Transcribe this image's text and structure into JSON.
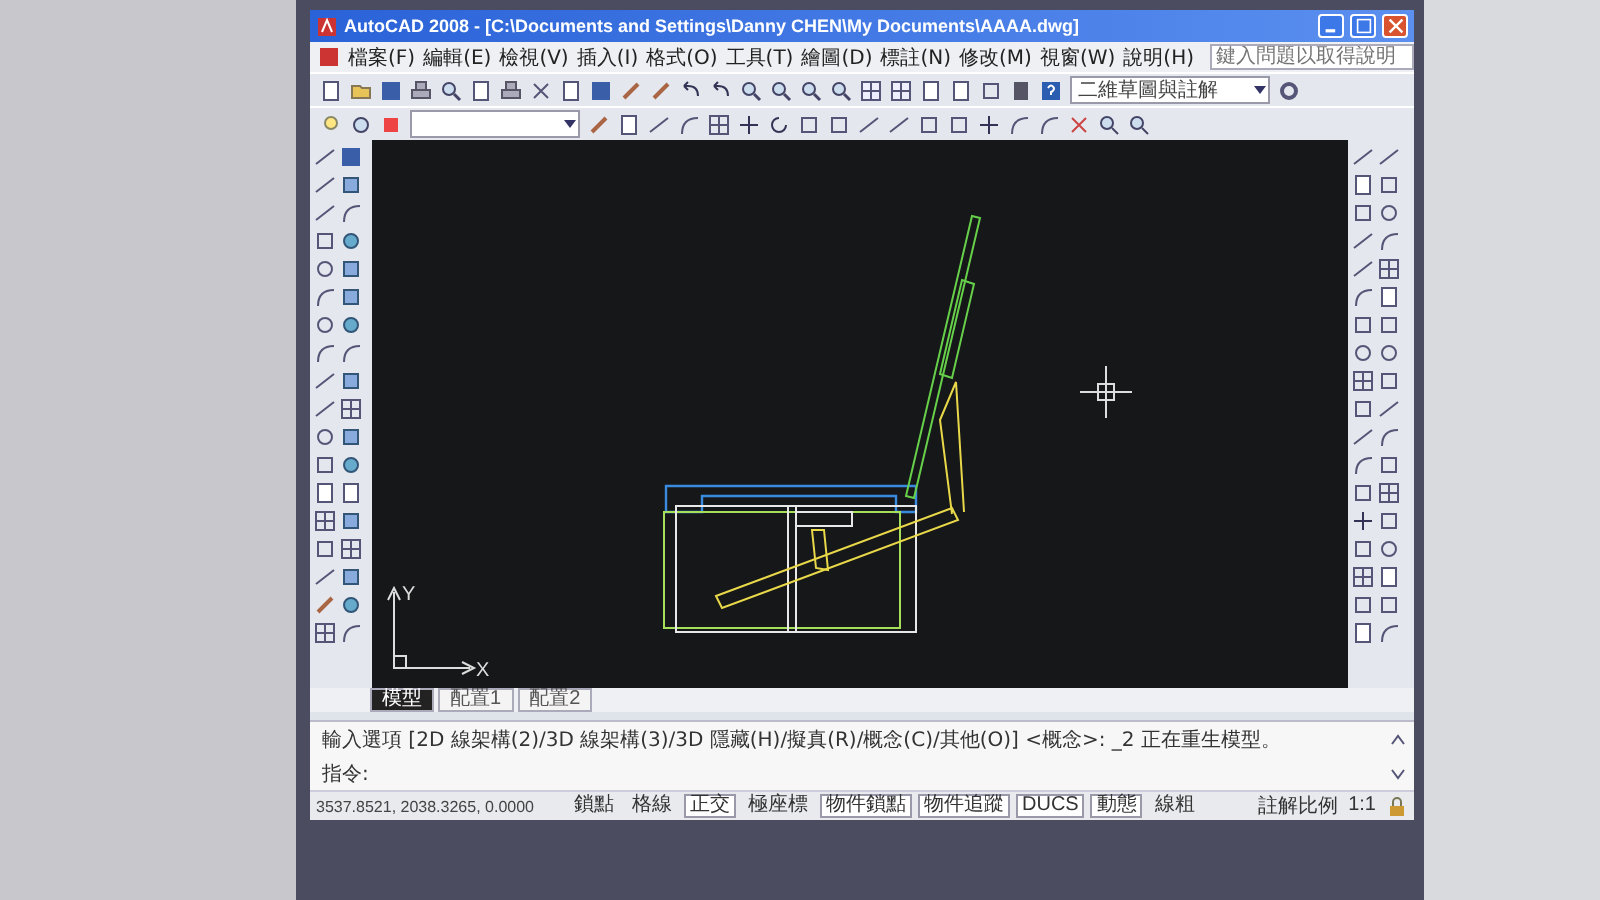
{
  "window": {
    "title": "AutoCAD 2008 - [C:\\Documents and Settings\\Danny CHEN\\My Documents\\AAAA.dwg]"
  },
  "menu": {
    "items": [
      "檔案(F)",
      "編輯(E)",
      "檢視(V)",
      "插入(I)",
      "格式(O)",
      "工具(T)",
      "繪圖(D)",
      "標註(N)",
      "修改(M)",
      "視窗(W)",
      "說明(H)"
    ]
  },
  "help_search": {
    "placeholder": "鍵入問題以取得說明"
  },
  "workspace_combo": {
    "value": "二維草圖與註解"
  },
  "ucs": {
    "x_label": "X",
    "y_label": "Y"
  },
  "layout_tabs": [
    {
      "label": "模型",
      "selected": true
    },
    {
      "label": "配置1",
      "selected": false
    },
    {
      "label": "配置2",
      "selected": false
    }
  ],
  "command_line": {
    "history": "輸入選項 [2D 線架構(2)/3D 線架構(3)/3D 隱藏(H)/擬真(R)/概念(C)/其他(O)] <概念>: _2 正在重生模型。",
    "prompt": "指令:"
  },
  "status_bar": {
    "coordinates": "3537.8521, 2038.3265, 0.0000",
    "toggles": [
      {
        "label": "鎖點",
        "on": false
      },
      {
        "label": "格線",
        "on": false
      },
      {
        "label": "正交",
        "on": true
      },
      {
        "label": "極座標",
        "on": false
      },
      {
        "label": "物件鎖點",
        "on": true
      },
      {
        "label": "物件追蹤",
        "on": true
      },
      {
        "label": "DUCS",
        "on": true
      },
      {
        "label": "動態",
        "on": true
      },
      {
        "label": "線粗",
        "on": false
      }
    ],
    "annotation_scale_label": "註解比例",
    "annotation_scale": "1:1"
  }
}
